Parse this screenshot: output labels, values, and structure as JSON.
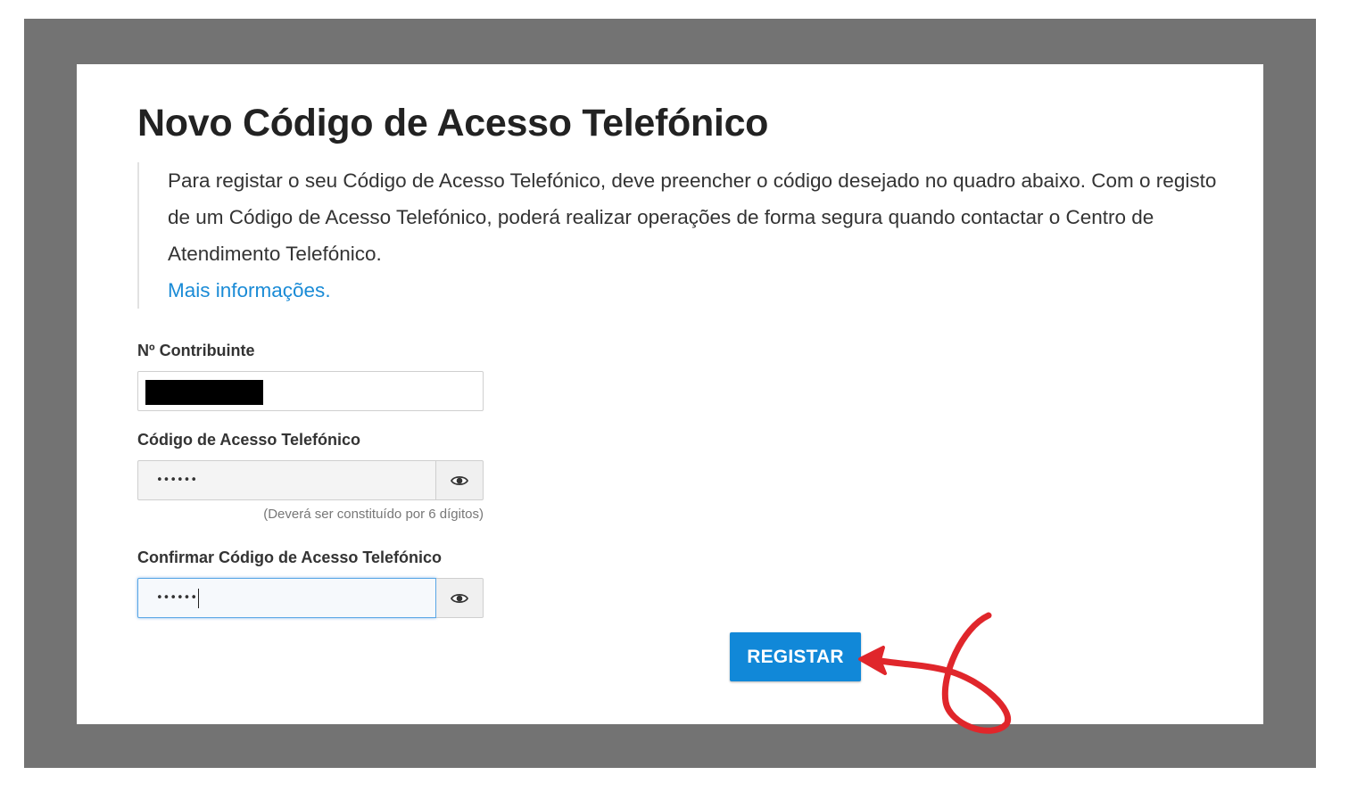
{
  "page": {
    "title": "Novo Código de Acesso Telefónico",
    "intro_text": "Para registar o seu Código de Acesso Telefónico, deve preencher o código desejado no quadro abaixo. Com o registo de um Código de Acesso Telefónico, poderá realizar operações de forma segura quando contactar o Centro de Atendimento Telefónico.",
    "more_info_link": "Mais informações",
    "more_info_suffix": "."
  },
  "form": {
    "nif": {
      "label": "Nº Contribuinte",
      "value_redacted": true
    },
    "code": {
      "label": "Código de Acesso Telefónico",
      "value_masked": "••••••",
      "hint": "(Deverá ser constituído por 6 dígitos)",
      "toggle_icon": "eye-icon"
    },
    "confirm_code": {
      "label": "Confirmar Código de Acesso Telefónico",
      "value_masked": "••••••",
      "toggle_icon": "eye-icon",
      "focused": true
    },
    "submit_label": "REGISTAR"
  },
  "colors": {
    "frame": "#737373",
    "link": "#1a8bd6",
    "button": "#1188d8",
    "annotation_arrow": "#e0262b"
  }
}
